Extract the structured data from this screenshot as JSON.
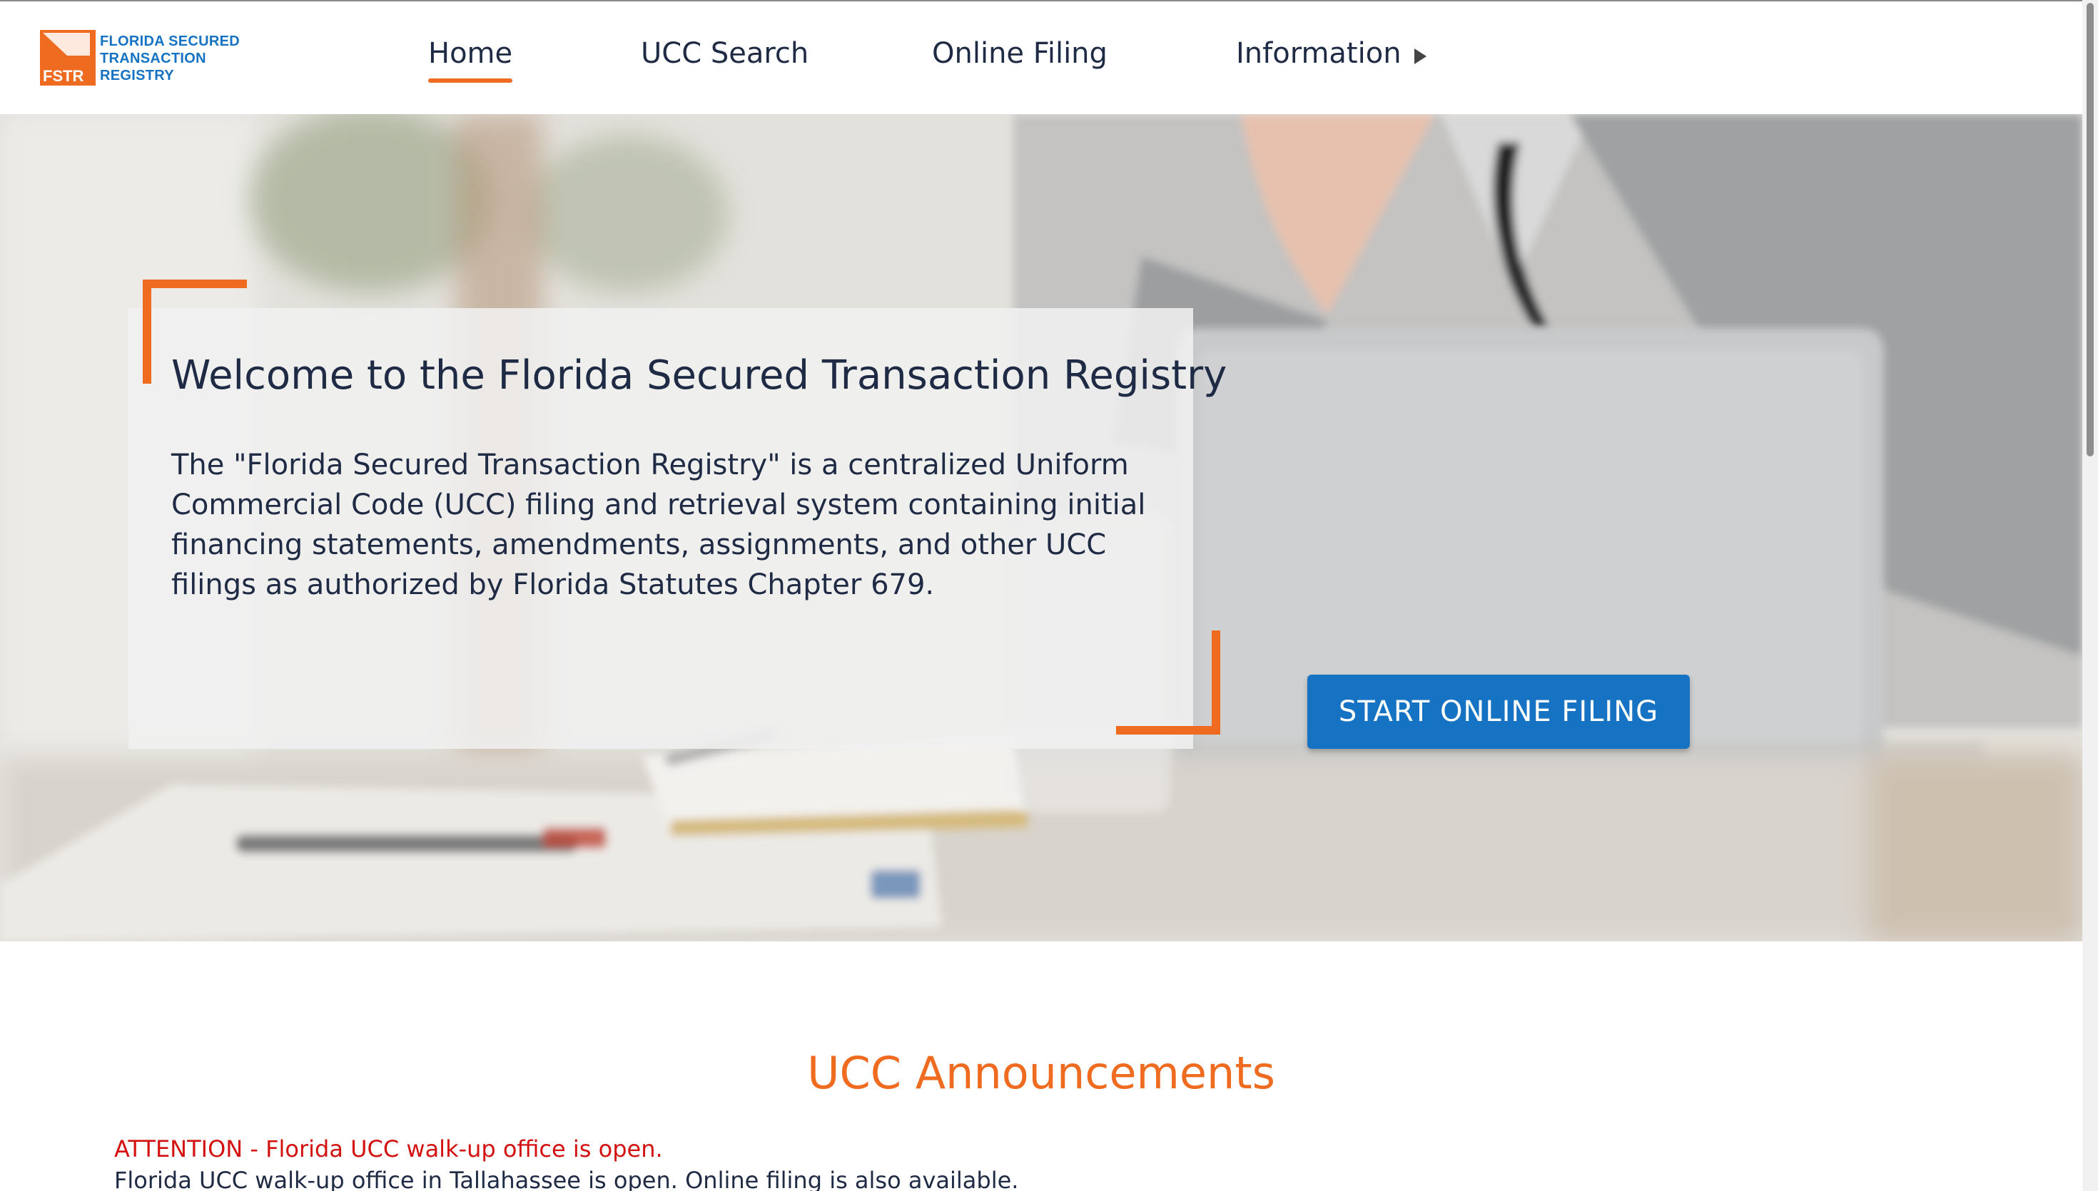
{
  "header": {
    "logo": {
      "abbr": "FSTR",
      "line1": "FLORIDA SECURED",
      "line2": "TRANSACTION",
      "line3": "REGISTRY"
    },
    "nav": {
      "home": "Home",
      "ucc_search": "UCC Search",
      "online_filing": "Online Filing",
      "information": "Information"
    }
  },
  "hero": {
    "title": "Welcome to the Florida Secured Transaction Registry",
    "body": "The \"Florida Secured Transaction Registry\" is a centralized Uniform Commercial Code (UCC) filing and retrieval system containing initial financing statements, amendments, assignments, and other UCC filings as authorized by Florida Statutes Chapter 679.",
    "cta_label": "START ONLINE FILING"
  },
  "announcements": {
    "title": "UCC Announcements",
    "items": [
      {
        "headline": "ATTENTION - Florida UCC walk-up office is open.",
        "text": "Florida UCC walk-up office in Tallahassee is open. Online filing is also available."
      }
    ],
    "prev_glyph": "‹",
    "next_glyph": "›"
  },
  "colors": {
    "accent_orange": "#ef6b1f",
    "primary_blue": "#1672c2",
    "text_navy": "#1f2a44",
    "alert_red": "#d41111"
  }
}
